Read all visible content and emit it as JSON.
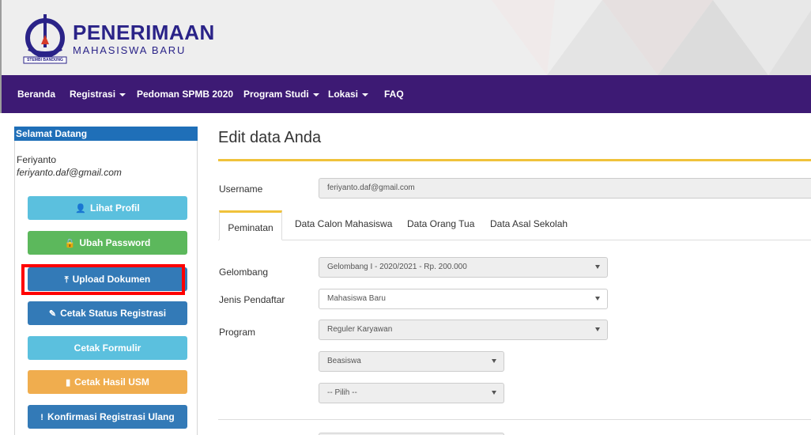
{
  "brand": {
    "title": "PENERIMAAN",
    "subtitle": "MAHASISWA BARU",
    "logo_text": "STEMBI BANDUNG"
  },
  "nav": {
    "items": [
      {
        "label": "Beranda",
        "dropdown": false
      },
      {
        "label": "Registrasi",
        "dropdown": true
      },
      {
        "label": "Pedoman SPMB 2020",
        "dropdown": false
      },
      {
        "label": "Program Studi",
        "dropdown": true
      },
      {
        "label": "Lokasi",
        "dropdown": true
      },
      {
        "label": "FAQ",
        "dropdown": false
      }
    ]
  },
  "sidebar": {
    "header": "Selamat Datang",
    "user_name": "Feriyanto",
    "user_email": "feriyanto.daf@gmail.com",
    "buttons": [
      {
        "label": "Lihat Profil",
        "icon": "user-icon",
        "glyph": "👤",
        "style": "info"
      },
      {
        "label": "Ubah Password",
        "icon": "lock-icon",
        "glyph": "🔒",
        "style": "success"
      },
      {
        "label": "Upload Dokumen",
        "icon": "upload-icon",
        "glyph": "⤒",
        "style": "primary"
      },
      {
        "label": "Cetak Status Registrasi",
        "icon": "edit-icon",
        "glyph": "✎",
        "style": "primary"
      },
      {
        "label": "Cetak Formulir",
        "icon": "",
        "glyph": "",
        "style": "info"
      },
      {
        "label": "Cetak Hasil USM",
        "icon": "file-icon",
        "glyph": "▮",
        "style": "warning"
      },
      {
        "label": "Konfirmasi Registrasi Ulang",
        "icon": "exclamation-icon",
        "glyph": "!",
        "style": "primary"
      }
    ]
  },
  "main": {
    "title": "Edit data Anda",
    "username_label": "Username",
    "username_value": "feriyanto.daf@gmail.com",
    "tabs": [
      {
        "label": "Peminatan",
        "active": true
      },
      {
        "label": "Data Calon Mahasiswa",
        "active": false
      },
      {
        "label": "Data Orang Tua",
        "active": false
      },
      {
        "label": "Data Asal Sekolah",
        "active": false
      }
    ],
    "fields": {
      "gelombang": {
        "label": "Gelombang",
        "value": "Gelombang I - 2020/2021 - Rp. 200.000"
      },
      "jenis": {
        "label": "Jenis Pendaftar",
        "value": "Mahasiswa Baru"
      },
      "program": {
        "label": "Program",
        "value": "Reguler Karyawan"
      },
      "beasiswa": {
        "value": "Beasiswa"
      },
      "pilih": {
        "value": "-- Pilih --"
      }
    }
  },
  "colors": {
    "navbar": "#3d1a74",
    "brand": "#2a2388",
    "accent": "#f0c23b",
    "highlight": "#ff0000"
  }
}
